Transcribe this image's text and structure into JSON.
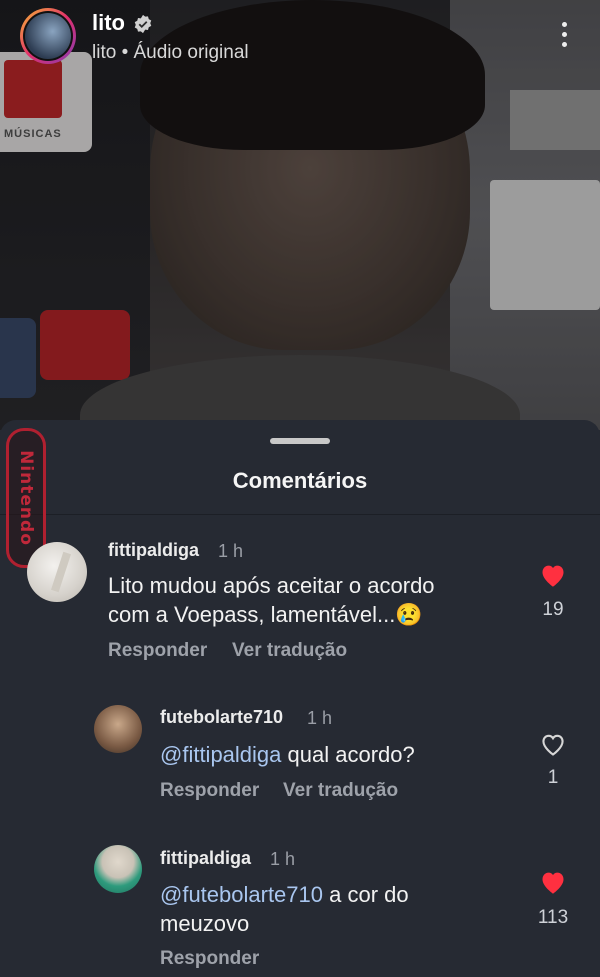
{
  "header": {
    "username": "lito",
    "subtitle": "lito • Áudio original",
    "background_poster_label": "MÚSICAS"
  },
  "watermark": {
    "text": "Nintendo"
  },
  "sheet": {
    "title": "Comentários"
  },
  "comments": [
    {
      "username": "fittipaldiga",
      "time": "1 h",
      "text_line1": "Lito mudou após aceitar o acordo",
      "text_line2": "com a Voepass, lamentável...😢",
      "reply_label": "Responder",
      "translate_label": "Ver tradução",
      "likes": "19",
      "liked": true
    },
    {
      "username": "futebolarte710",
      "time": "1 h",
      "mention": "@fittipaldiga",
      "text": " qual acordo?",
      "reply_label": "Responder",
      "translate_label": "Ver tradução",
      "likes": "1",
      "liked": false
    },
    {
      "username": "fittipaldiga",
      "time": "1 h",
      "mention": "@futebolarte710",
      "text_line1": " a cor do",
      "text_line2": "meuzovo",
      "reply_label": "Responder",
      "likes": "113",
      "liked": true
    }
  ],
  "colors": {
    "sheet_bg": "#262a33",
    "like_red": "#ff3040",
    "mention_blue": "#a9c6ef",
    "watermark_red": "#c0283a"
  }
}
